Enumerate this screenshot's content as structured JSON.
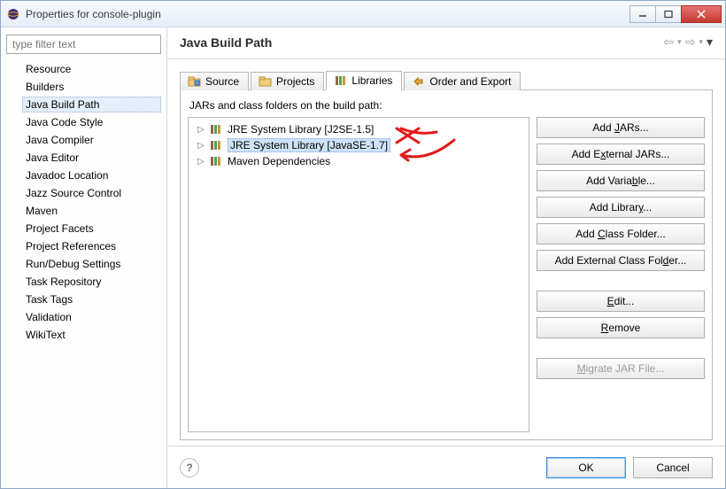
{
  "window": {
    "title": "Properties for console-plugin"
  },
  "filter": {
    "placeholder": "type filter text"
  },
  "nav": {
    "items": [
      "Resource",
      "Builders",
      "Java Build Path",
      "Java Code Style",
      "Java Compiler",
      "Java Editor",
      "Javadoc Location",
      "Jazz Source Control",
      "Maven",
      "Project Facets",
      "Project References",
      "Run/Debug Settings",
      "Task Repository",
      "Task Tags",
      "Validation",
      "WikiText"
    ],
    "selected_index": 2
  },
  "page": {
    "heading": "Java Build Path"
  },
  "tabs": {
    "items": [
      "Source",
      "Projects",
      "Libraries",
      "Order and Export"
    ],
    "active_index": 2
  },
  "libs": {
    "caption": "JARs and class folders on the build path:",
    "items": [
      "JRE System Library [J2SE-1.5]",
      "JRE System Library [JavaSE-1.7]",
      "Maven Dependencies"
    ],
    "selected_index": 1
  },
  "buttons": {
    "add_jars": "Add JARs...",
    "add_ext_jars": "Add External JARs...",
    "add_variable": "Add Variable...",
    "add_library": "Add Library...",
    "add_class_folder": "Add Class Folder...",
    "add_ext_class_folder": "Add External Class Folder...",
    "edit": "Edit...",
    "remove": "Remove",
    "migrate": "Migrate JAR File..."
  },
  "footer": {
    "ok": "OK",
    "cancel": "Cancel"
  }
}
